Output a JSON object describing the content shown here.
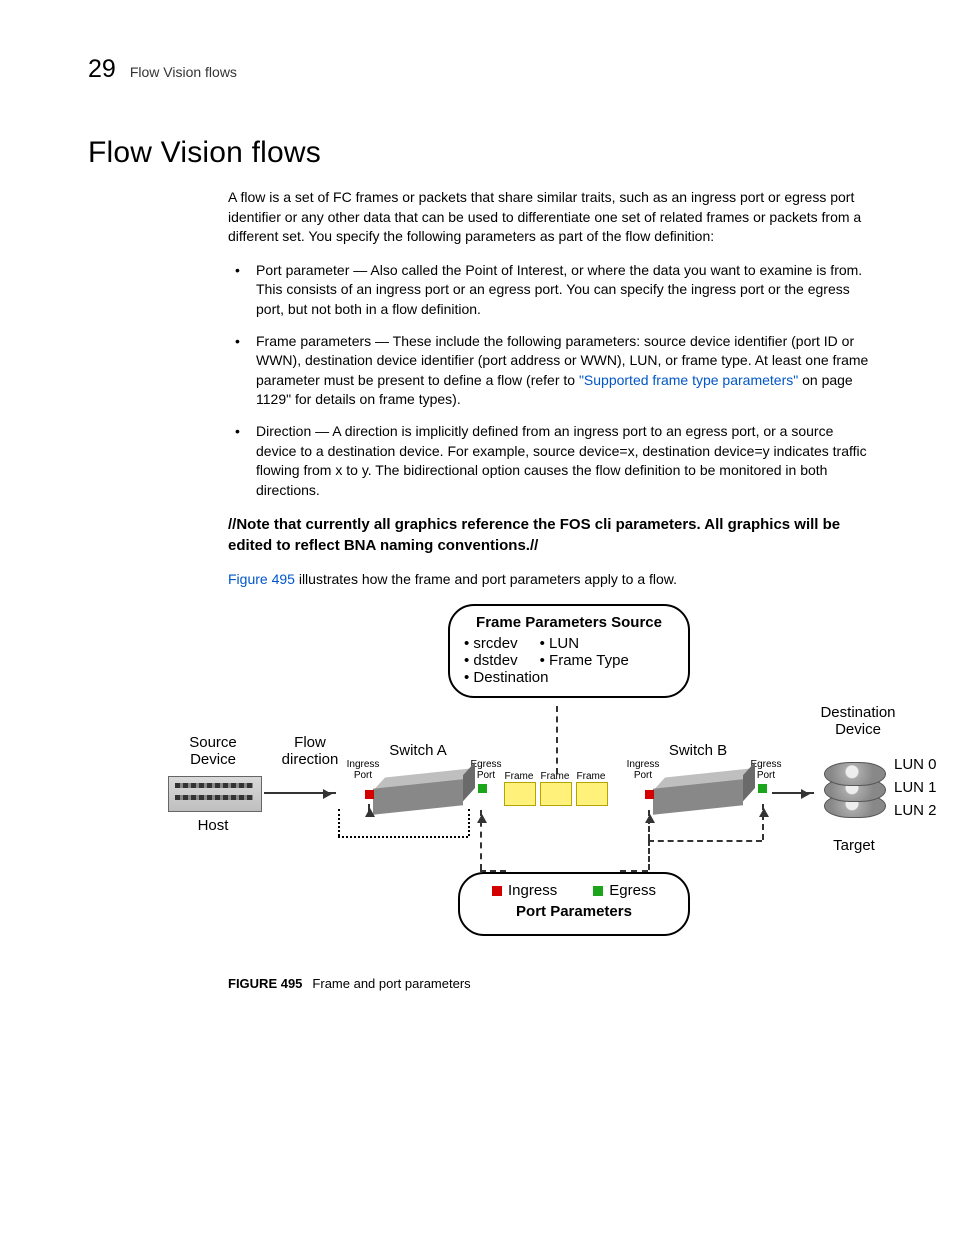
{
  "header": {
    "chapter": "29",
    "running": "Flow Vision flows"
  },
  "h1": "Flow Vision flows",
  "intro": "A flow is a set of FC frames or packets that share similar traits, such as an ingress port or egress port identifier or any other data that can be used to differentiate one set of related frames or packets from a different set. You specify the following parameters as part of the flow definition:",
  "bullets": [
    {
      "lead": "Port parameter",
      "text": " — Also called the Point of Interest, or where the data you want to examine is from. This consists of an ingress port or an egress port. You can specify the ingress port or the egress port, but not both in a flow definition."
    },
    {
      "lead": "Frame parameters",
      "pre": " — These include the following parameters: source device identifier (port ID or WWN), destination device identifier (port address or WWN), LUN, or frame type. At least one frame parameter must be present to define a flow (refer to ",
      "link": "\"Supported frame type parameters\"",
      "post": " on page 1129\" for details on frame types)."
    },
    {
      "lead": "Direction",
      "text": " — A direction is implicitly defined from an ingress port to an egress port, or a source device to a destination device. For example, source device=x, destination device=y indicates traffic flowing from x to y. The bidirectional option causes the flow definition to be monitored in both directions."
    }
  ],
  "note": "//Note that currently all graphics reference the FOS cli parameters. All graphics will be edited to reflect BNA naming conventions.//",
  "figline": {
    "ref": "Figure 495",
    "rest": " illustrates how the frame and port parameters apply to a flow."
  },
  "diagram": {
    "frame_params_title": "Frame Parameters Source",
    "frame_params": [
      "srcdev",
      "LUN",
      "dstdev",
      "Frame Type",
      "Destination"
    ],
    "port_params_title": "Port Parameters",
    "legend": {
      "ingress": "Ingress",
      "egress": "Egress"
    },
    "labels": {
      "source_device": "Source\nDevice",
      "host": "Host",
      "flow_direction": "Flow\ndirection",
      "switch_a": "Switch A",
      "switch_b": "Switch B",
      "ingress_port": "Ingress\nPort",
      "egress_port": "Egress\nPort",
      "frame": "Frame",
      "destination_device": "Destination\nDevice",
      "target": "Target",
      "luns": [
        "LUN 0",
        "LUN 1",
        "LUN 2"
      ]
    }
  },
  "figcap": {
    "num": "FIGURE 495",
    "title": "Frame and port parameters"
  }
}
